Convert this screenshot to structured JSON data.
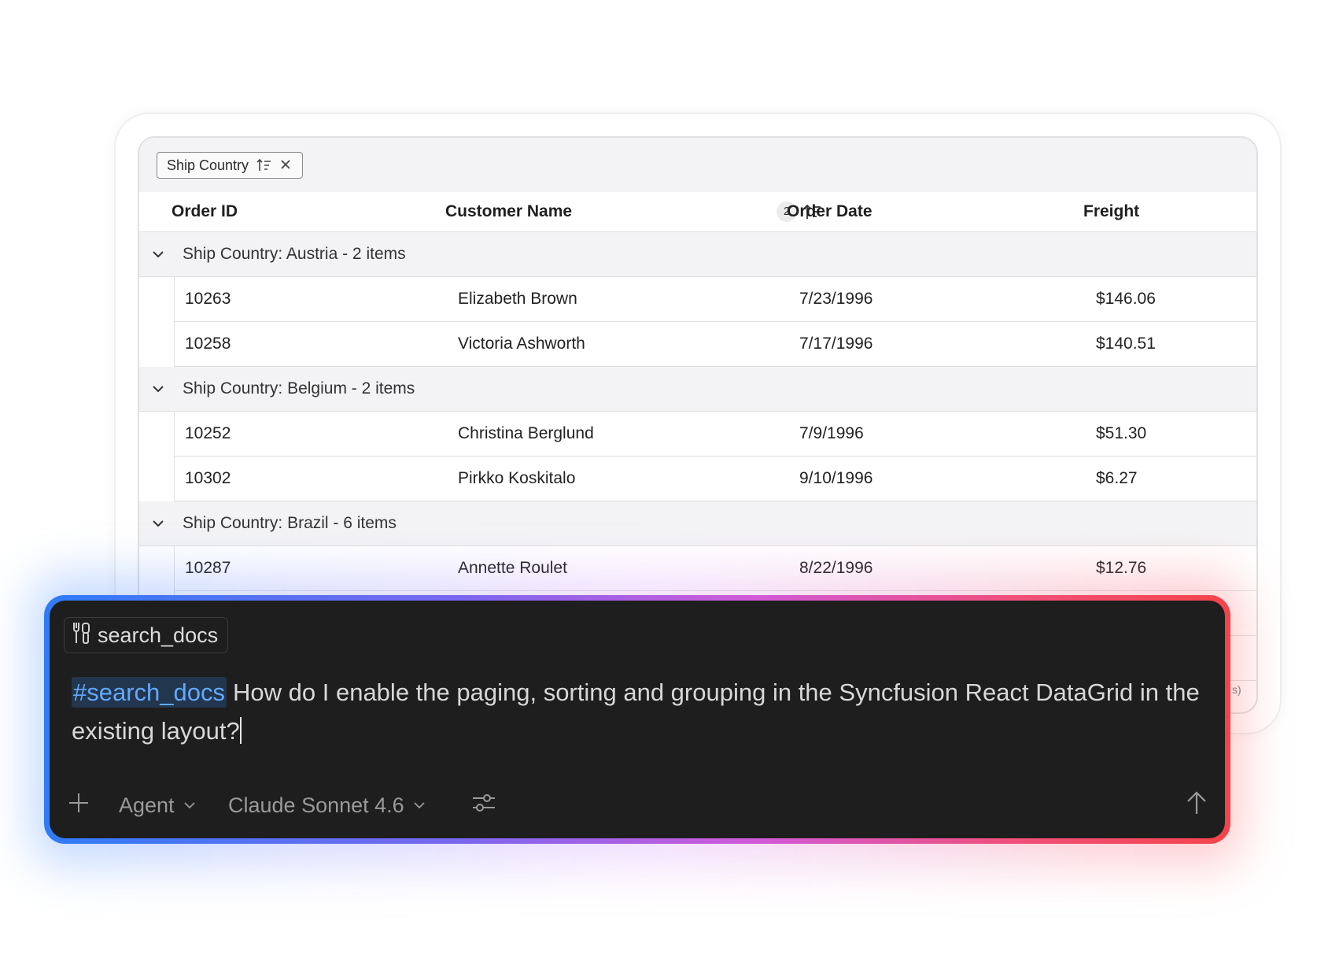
{
  "grid": {
    "group_chip": {
      "label": "Ship Country"
    },
    "columns": [
      {
        "label": "Order ID"
      },
      {
        "label": "Customer Name"
      },
      {
        "label": "Order Date"
      },
      {
        "label": "Freight"
      }
    ],
    "sort_number": "2",
    "groups": [
      {
        "caption": "Ship Country: Austria - 2 items",
        "rows": [
          [
            "10263",
            "Elizabeth Brown",
            "7/23/1996",
            "$146.06"
          ],
          [
            "10258",
            "Victoria Ashworth",
            "7/17/1996",
            "$140.51"
          ]
        ]
      },
      {
        "caption": "Ship Country: Belgium - 2 items",
        "rows": [
          [
            "10252",
            "Christina Berglund",
            "7/9/1996",
            "$51.30"
          ],
          [
            "10302",
            "Pirkko Koskitalo",
            "9/10/1996",
            "$6.27"
          ]
        ]
      },
      {
        "caption": "Ship Country: Brazil - 6 items",
        "rows": [
          [
            "10287",
            "Annette Roulet",
            "8/22/1996",
            "$12.76"
          ]
        ]
      }
    ],
    "pager_peek": "s)"
  },
  "chat": {
    "tool_chip": "search_docs",
    "prompt_tag": "#search_docs",
    "prompt_text": "How do I enable the paging, sorting and grouping in the Syncfusion React DataGrid in the existing layout?",
    "mode": "Agent",
    "model": "Claude Sonnet 4.6",
    "colors": {
      "tag_bg": "#22364e",
      "tag_text": "#63a9ff",
      "panel_bg": "#1e1e1e"
    }
  }
}
